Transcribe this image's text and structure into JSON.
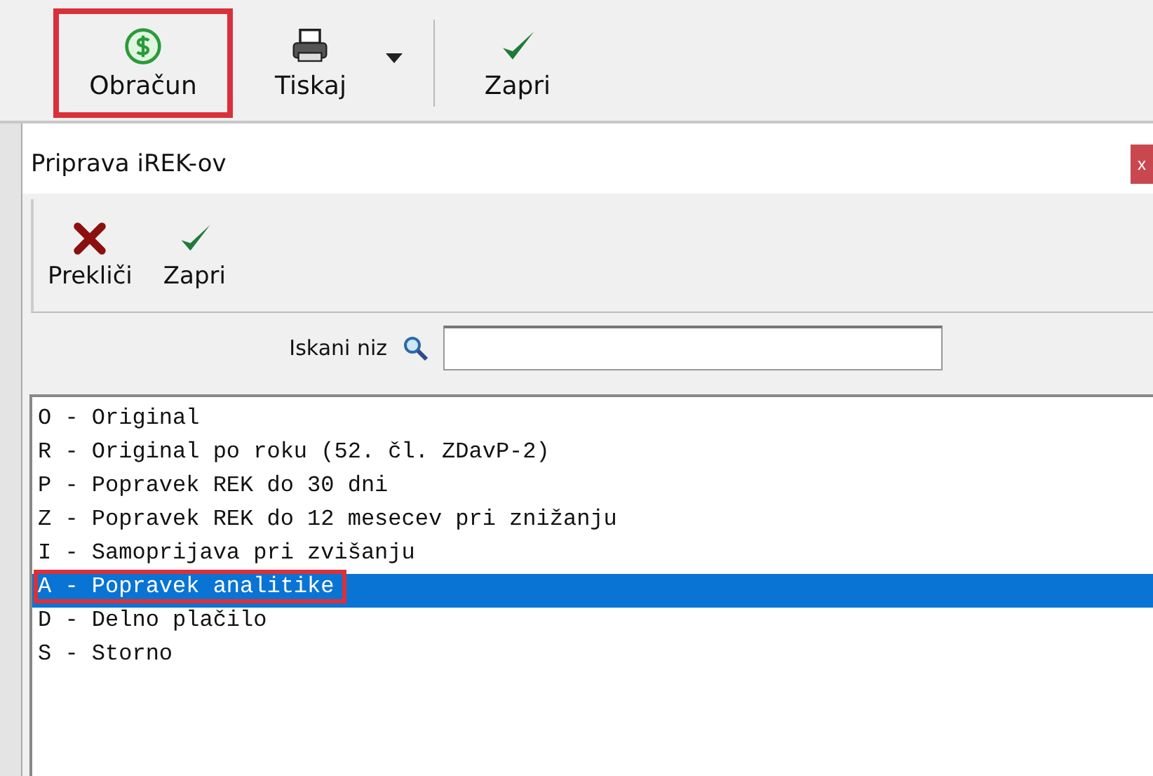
{
  "main_toolbar": {
    "buttons": [
      {
        "kind": "dollar",
        "label": "Obračun",
        "highlighted": true,
        "dropdown": false
      },
      {
        "kind": "printer",
        "label": "Tiskaj",
        "highlighted": false,
        "dropdown": true
      },
      {
        "kind": "check",
        "label": "Zapri",
        "highlighted": false,
        "dropdown": false
      }
    ]
  },
  "dialog": {
    "title": "Priprava iREK-ov",
    "toolbar": {
      "buttons": [
        {
          "kind": "cross",
          "label": "Prekliči"
        },
        {
          "kind": "check",
          "label": "Zapri"
        }
      ]
    },
    "close_label": "x",
    "search": {
      "label": "Iskani niz"
    },
    "list": {
      "items": [
        {
          "label": "O - Original",
          "selected": false,
          "highlighted": false
        },
        {
          "label": "R - Original po roku (52. čl. ZDavP-2)",
          "selected": false,
          "highlighted": false
        },
        {
          "label": "P - Popravek REK do 30 dni",
          "selected": false,
          "highlighted": false
        },
        {
          "label": "Z - Popravek REK do 12 mesecev pri znižanju",
          "selected": false,
          "highlighted": false
        },
        {
          "label": "I - Samoprijava pri zvišanju",
          "selected": false,
          "highlighted": false
        },
        {
          "label": "A - Popravek analitike",
          "selected": true,
          "highlighted": true
        },
        {
          "label": "D - Delno plačilo",
          "selected": false,
          "highlighted": false
        },
        {
          "label": "S - Storno",
          "selected": false,
          "highlighted": false
        }
      ]
    }
  }
}
